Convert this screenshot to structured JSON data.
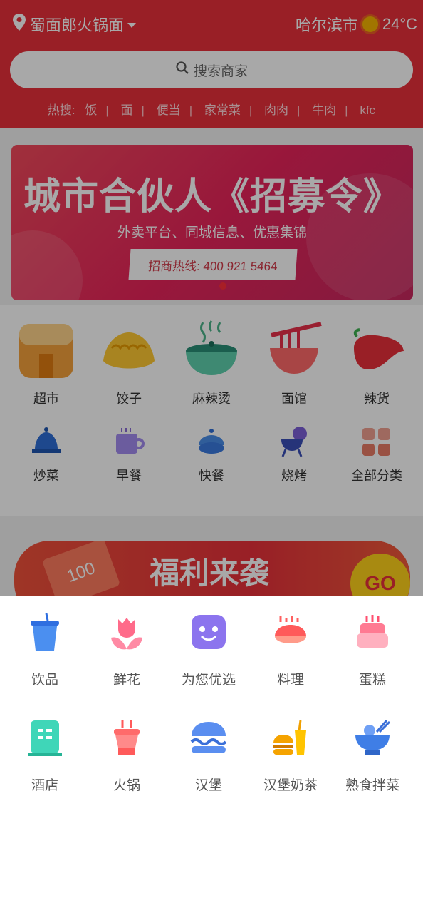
{
  "header": {
    "location": "蜀面郎火锅面",
    "city": "哈尔滨市",
    "temperature": "24°C",
    "search_placeholder": "搜索商家",
    "hot_label": "热搜:",
    "hot_terms": [
      "饭",
      "面",
      "便当",
      "家常菜",
      "肉肉",
      "牛肉",
      "kfc"
    ]
  },
  "banner": {
    "title": "城市合伙人《招募令》",
    "subtitle": "外卖平台、同城信息、优惠集锦",
    "hotline": "招商热线: 400 921 5464"
  },
  "categories": [
    {
      "label": "超市",
      "icon": "store-icon"
    },
    {
      "label": "饺子",
      "icon": "dumpling-icon"
    },
    {
      "label": "麻辣烫",
      "icon": "hotpot-bowl-icon"
    },
    {
      "label": "面馆",
      "icon": "noodle-icon"
    },
    {
      "label": "辣货",
      "icon": "chili-icon"
    },
    {
      "label": "炒菜",
      "icon": "bell-dish-icon"
    },
    {
      "label": "早餐",
      "icon": "coffee-cup-icon"
    },
    {
      "label": "快餐",
      "icon": "covered-dish-icon"
    },
    {
      "label": "烧烤",
      "icon": "grill-icon"
    },
    {
      "label": "全部分类",
      "icon": "grid-icon"
    }
  ],
  "promo": {
    "title": "福利来袭",
    "coupon": "100",
    "go": "GO"
  },
  "sheet": {
    "items": [
      {
        "label": "饮品",
        "icon": "drink-cup-icon"
      },
      {
        "label": "鲜花",
        "icon": "flower-icon"
      },
      {
        "label": "为您优选",
        "icon": "smiley-box-icon"
      },
      {
        "label": "料理",
        "icon": "sushi-icon"
      },
      {
        "label": "蛋糕",
        "icon": "cake-icon"
      },
      {
        "label": "酒店",
        "icon": "hotel-building-icon"
      },
      {
        "label": "火锅",
        "icon": "hotpot-icon"
      },
      {
        "label": "汉堡",
        "icon": "burger-icon"
      },
      {
        "label": "汉堡奶茶",
        "icon": "burger-milktea-icon"
      },
      {
        "label": "熟食拌菜",
        "icon": "bowl-chopsticks-icon"
      }
    ]
  }
}
